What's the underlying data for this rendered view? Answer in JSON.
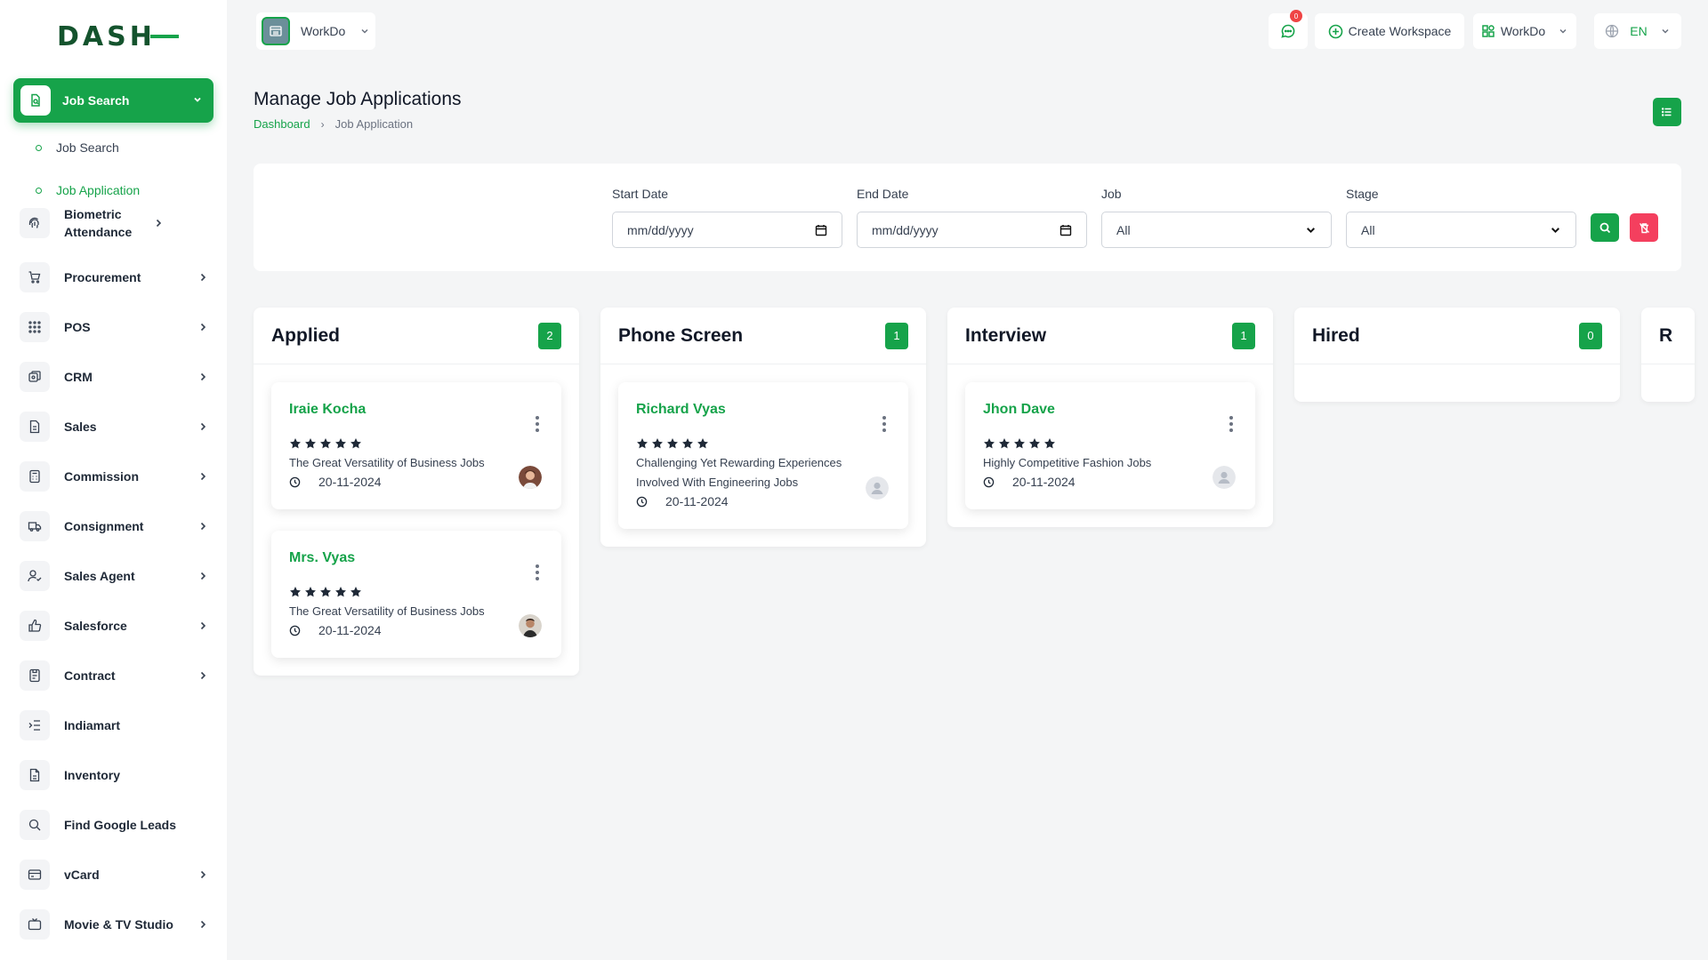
{
  "brand": {
    "logo_text": "DASH"
  },
  "sidebar": {
    "active": {
      "label": "Job Search"
    },
    "sub_items": [
      {
        "label": "Job Search"
      },
      {
        "label": "Job Application"
      }
    ],
    "items": [
      {
        "label": "Biometric Attendance",
        "icon": "fingerprint-icon",
        "has_chevron": true
      },
      {
        "label": "Procurement",
        "icon": "cart-icon",
        "has_chevron": true
      },
      {
        "label": "POS",
        "icon": "grid-icon",
        "has_chevron": true
      },
      {
        "label": "CRM",
        "icon": "crm-icon",
        "has_chevron": true
      },
      {
        "label": "Sales",
        "icon": "document-icon",
        "has_chevron": true
      },
      {
        "label": "Commission",
        "icon": "calculator-icon",
        "has_chevron": true
      },
      {
        "label": "Consignment",
        "icon": "truck-icon",
        "has_chevron": true
      },
      {
        "label": "Sales Agent",
        "icon": "user-check-icon",
        "has_chevron": true
      },
      {
        "label": "Salesforce",
        "icon": "thumbs-up-icon",
        "has_chevron": true
      },
      {
        "label": "Contract",
        "icon": "contract-icon",
        "has_chevron": true
      },
      {
        "label": "Indiamart",
        "icon": "indent-icon",
        "has_chevron": false
      },
      {
        "label": "Inventory",
        "icon": "file-icon",
        "has_chevron": false
      },
      {
        "label": "Find Google Leads",
        "icon": "search-icon",
        "has_chevron": false
      },
      {
        "label": "vCard",
        "icon": "card-icon",
        "has_chevron": true
      },
      {
        "label": "Movie & TV Studio",
        "icon": "tv-icon",
        "has_chevron": true
      }
    ]
  },
  "topbar": {
    "workspace": "WorkDo",
    "notification_count": "0",
    "create_workspace": "Create Workspace",
    "user_workspace": "WorkDo",
    "language": "EN"
  },
  "page": {
    "title": "Manage Job Applications",
    "breadcrumb": {
      "home": "Dashboard",
      "current": "Job Application"
    }
  },
  "filters": {
    "start_date": {
      "label": "Start Date",
      "value": "mm/dd/yyyy"
    },
    "end_date": {
      "label": "End Date",
      "value": "mm/dd/yyyy"
    },
    "job": {
      "label": "Job",
      "value": "All"
    },
    "stage": {
      "label": "Stage",
      "value": "All"
    }
  },
  "columns": [
    {
      "title": "Applied",
      "count": "2",
      "cards": [
        {
          "name": "Iraie Kocha",
          "rating": 5,
          "job": "The Great Versatility of Business Jobs",
          "date": "20-11-2024",
          "avatar": "photo-female"
        },
        {
          "name": "Mrs. Vyas",
          "rating": 5,
          "job": "The Great Versatility of Business Jobs",
          "date": "20-11-2024",
          "avatar": "photo-male"
        }
      ]
    },
    {
      "title": "Phone Screen",
      "count": "1",
      "cards": [
        {
          "name": "Richard Vyas",
          "rating": 5,
          "job": "Challenging Yet Rewarding Experiences Involved With Engineering Jobs",
          "date": "20-11-2024",
          "avatar": "placeholder"
        }
      ]
    },
    {
      "title": "Interview",
      "count": "1",
      "cards": [
        {
          "name": "Jhon Dave",
          "rating": 5,
          "job": "Highly Competitive Fashion Jobs",
          "date": "20-11-2024",
          "avatar": "placeholder"
        }
      ]
    },
    {
      "title": "Hired",
      "count": "0",
      "cards": []
    },
    {
      "title": "R",
      "count": "",
      "cards": []
    }
  ],
  "colors": {
    "accent": "#16a34a",
    "danger": "#f43f5e",
    "badge": "#ef4444"
  }
}
